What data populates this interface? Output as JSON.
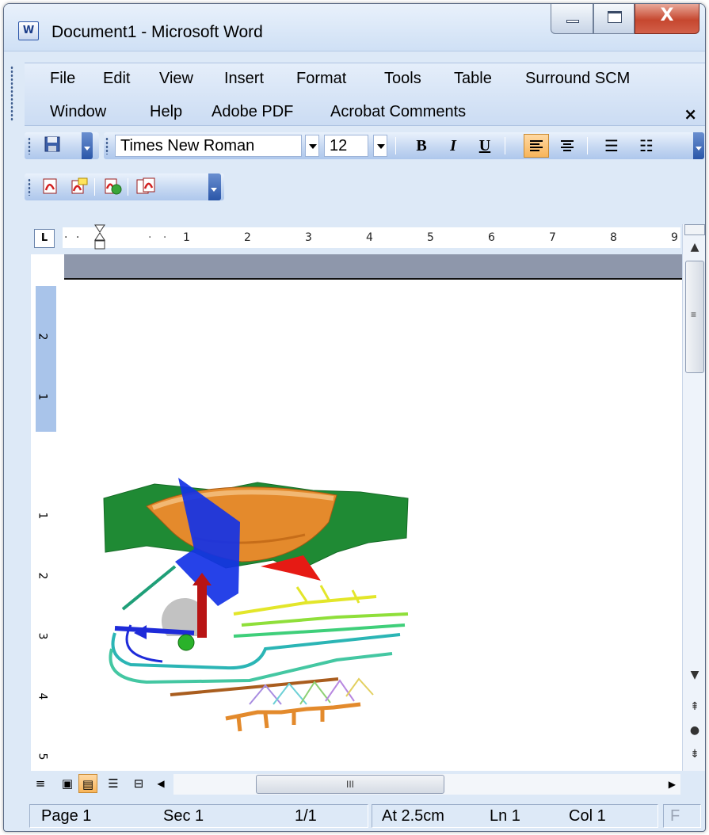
{
  "window": {
    "title": "Document1 - Microsoft Word",
    "app_icon_glyph": "W",
    "close_glyph": "X"
  },
  "menubar": {
    "row1": [
      "File",
      "Edit",
      "View",
      "Insert",
      "Format",
      "Tools",
      "Table",
      "Surround SCM"
    ],
    "row2": [
      "Window",
      "Help",
      "Adobe PDF",
      "Acrobat Comments"
    ],
    "close_glyph": "×"
  },
  "formatting_toolbar": {
    "font_name": "Times New Roman",
    "font_size": "12",
    "bold_label": "B",
    "italic_label": "I",
    "underline_label": "U"
  },
  "ruler": {
    "tab_selector": "L",
    "labels": [
      "1",
      "2",
      "3",
      "4",
      "5",
      "6",
      "7",
      "8",
      "9"
    ],
    "vertical_labels": [
      "2",
      "1",
      "1",
      "2",
      "3",
      "4",
      "5"
    ]
  },
  "hscroll": {
    "thumb_grip": "III"
  },
  "statusbar": {
    "page": "Page 1",
    "sec": "Sec 1",
    "pages": "1/1",
    "at": "At 2.5cm",
    "ln": "Ln 1",
    "col": "Col 1",
    "last": "F"
  },
  "colors": {
    "accent_active": "#f8b55a",
    "toolbar_blue": "#c3d6f1",
    "close_red": "#c6472f"
  }
}
